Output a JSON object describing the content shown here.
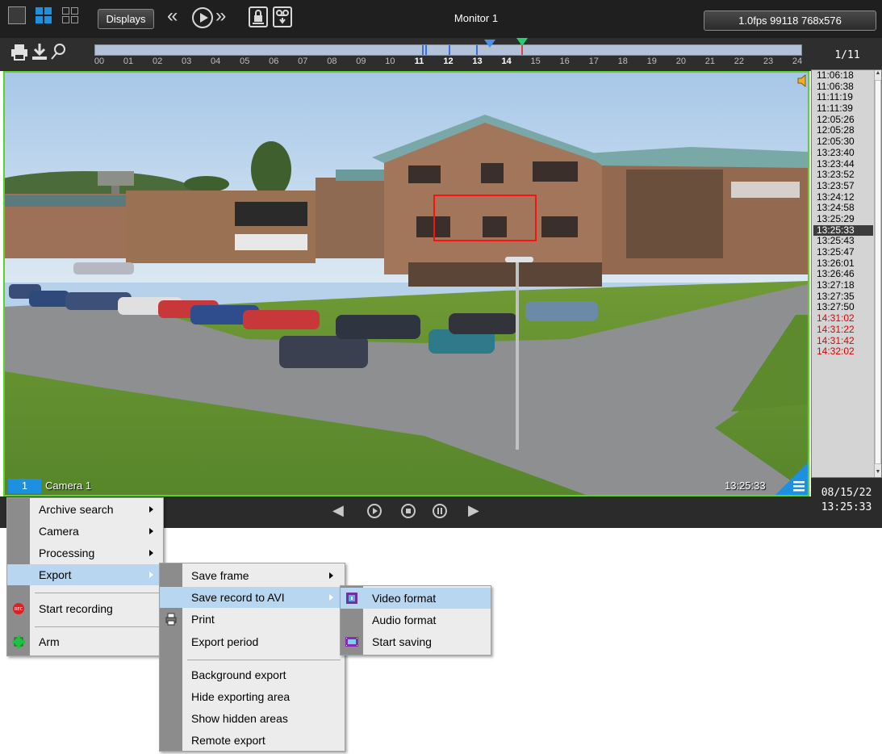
{
  "toolbar": {
    "displays_label": "Displays",
    "rewind_glyph": "«",
    "forward_glyph": "»",
    "monitor_title": "Monitor 1",
    "stream_info": "1.0fps  99118  768x576"
  },
  "icons": {
    "layout_single": "square-layout-icon",
    "layout_quad": "quad-layout-icon",
    "layout_multi": "multi-layout-icon",
    "rewind": "rewind-icon",
    "play": "play-icon",
    "forward": "fast-forward-icon",
    "lock": "lock-icon",
    "tape": "tape-download-icon",
    "print": "printer-icon",
    "download": "download-icon",
    "search": "search-icon",
    "speaker": "speaker-icon",
    "menu": "hamburger-menu-icon"
  },
  "timeline": {
    "ticks": [
      "00",
      "01",
      "02",
      "03",
      "04",
      "05",
      "06",
      "07",
      "08",
      "09",
      "10",
      "11",
      "12",
      "13",
      "14",
      "15",
      "16",
      "17",
      "18",
      "19",
      "20",
      "21",
      "22",
      "23",
      "24"
    ],
    "page_counter": "1/11"
  },
  "camera": {
    "number": "1",
    "name": "Camera 1",
    "timestamp": "13:25:33"
  },
  "events": {
    "times": [
      "11:06:18",
      "11:06:38",
      "11:11:19",
      "11:11:39",
      "12:05:26",
      "12:05:28",
      "12:05:30",
      "13:23:40",
      "13:23:44",
      "13:23:52",
      "13:23:57",
      "13:24:12",
      "13:24:58",
      "13:25:29",
      "13:25:33",
      "13:25:43",
      "13:25:47",
      "13:26:01",
      "13:26:46",
      "13:27:18",
      "13:27:35",
      "13:27:50",
      "14:31:02",
      "14:31:22",
      "14:31:42",
      "14:32:02"
    ],
    "selected": "13:25:33",
    "alarm_color": "#e00000"
  },
  "date_box": {
    "date": "08/15/22",
    "time": "13:25:33"
  },
  "playback": {
    "prev_glyph": "◀",
    "next_glyph": "▶"
  },
  "context_menu": {
    "items": [
      {
        "label": "Archive search",
        "submenu": true
      },
      {
        "label": "Camera",
        "submenu": true
      },
      {
        "label": "Processing",
        "submenu": true
      },
      {
        "label": "Export",
        "submenu": true,
        "highlighted": true
      },
      {
        "label": "Start recording",
        "icon": "rec-icon"
      },
      {
        "label": "Arm",
        "icon": "arm-icon"
      }
    ]
  },
  "export_menu": {
    "items": [
      {
        "label": "Save frame",
        "submenu": true
      },
      {
        "label": "Save record to AVI",
        "submenu": true,
        "highlighted": true
      },
      {
        "label": "Print",
        "icon": "print-icon"
      },
      {
        "label": "Export period"
      },
      {
        "label": "Background export"
      },
      {
        "label": "Hide exporting area"
      },
      {
        "label": "Show hidden areas"
      },
      {
        "label": "Remote export"
      }
    ]
  },
  "avi_menu": {
    "items": [
      {
        "label": "Video format",
        "icon": "video-format-icon",
        "highlighted": true
      },
      {
        "label": "Audio format"
      },
      {
        "label": "Start saving",
        "icon": "film-icon"
      }
    ]
  },
  "colors": {
    "accent_blue": "#1e90e0",
    "frame_green": "#5fd12a",
    "menu_highlight": "#b8d6f0"
  }
}
